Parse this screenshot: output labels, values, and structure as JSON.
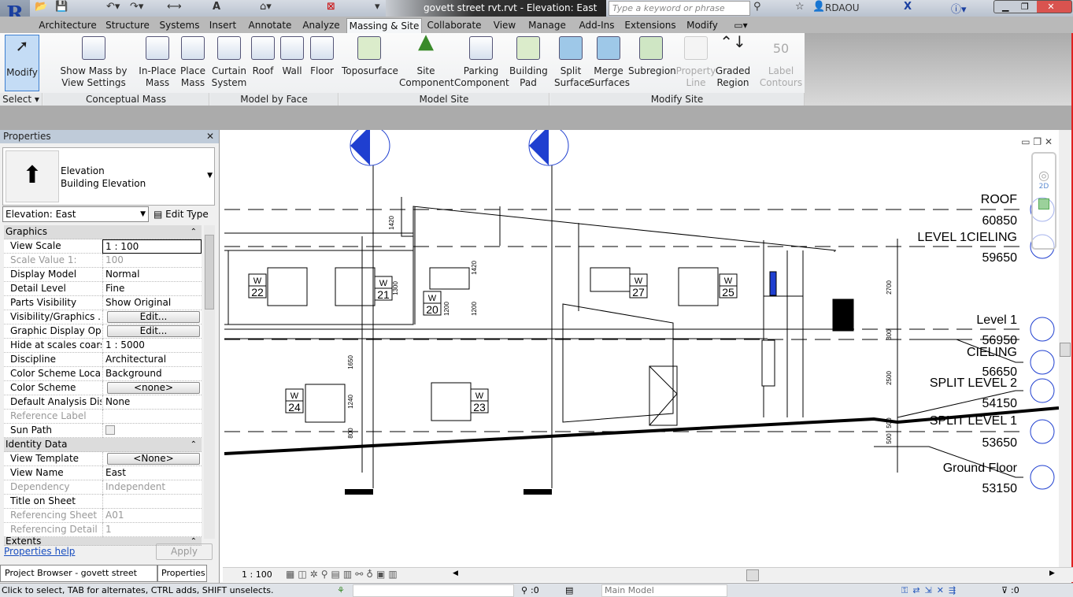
{
  "titlebar": {
    "document_title": "govett street rvt.rvt - Elevation: East",
    "search_placeholder": "Type a keyword or phrase",
    "user": "RDAOU"
  },
  "tabs": [
    "Architecture",
    "Structure",
    "Systems",
    "Insert",
    "Annotate",
    "Analyze",
    "Massing & Site",
    "Collaborate",
    "View",
    "Manage",
    "Add-Ins",
    "Extensions",
    "Modify"
  ],
  "active_tab": "Massing & Site",
  "ribbon": {
    "select": {
      "button": "Modify",
      "panel": "Select"
    },
    "conceptual_mass": {
      "panel": "Conceptual Mass",
      "buttons": [
        "Show Mass by View Settings",
        "In-Place Mass",
        "Place Mass"
      ]
    },
    "model_by_face": {
      "panel": "Model by Face",
      "buttons": [
        "Curtain System",
        "Roof",
        "Wall",
        "Floor"
      ]
    },
    "model_site": {
      "panel": "Model Site",
      "buttons": [
        "Toposurface",
        "Site Component",
        "Parking Component",
        "Building Pad"
      ]
    },
    "modify_site": {
      "panel": "Modify Site",
      "buttons": [
        "Split Surface",
        "Merge Surfaces",
        "Subregion",
        "Property Line",
        "Graded Region",
        "Label Contours"
      ],
      "disabled": [
        "Property Line",
        "Label Contours"
      ]
    }
  },
  "properties": {
    "title": "Properties",
    "type_family": "Elevation",
    "type_name": "Building Elevation",
    "instance_selector": "Elevation: East",
    "edit_type": "Edit Type",
    "sections": {
      "graphics": "Graphics",
      "identity": "Identity Data",
      "extents": "Extents"
    },
    "rows": [
      {
        "k": "View Scale",
        "v": "1 : 100"
      },
      {
        "k": "Scale Value    1:",
        "v": "100"
      },
      {
        "k": "Display Model",
        "v": "Normal"
      },
      {
        "k": "Detail Level",
        "v": "Fine"
      },
      {
        "k": "Parts Visibility",
        "v": "Show Original"
      },
      {
        "k": "Visibility/Graphics ...",
        "v": "Edit..."
      },
      {
        "k": "Graphic Display Opt...",
        "v": "Edit..."
      },
      {
        "k": "Hide at scales coars...",
        "v": "1 : 5000"
      },
      {
        "k": "Discipline",
        "v": "Architectural"
      },
      {
        "k": "Color Scheme Loca...",
        "v": "Background"
      },
      {
        "k": "Color Scheme",
        "v": "<none>"
      },
      {
        "k": "Default Analysis Dis...",
        "v": "None"
      },
      {
        "k": "Reference Label",
        "v": ""
      },
      {
        "k": "Sun Path",
        "v": ""
      },
      {
        "k": "View Template",
        "v": "<None>"
      },
      {
        "k": "View Name",
        "v": "East"
      },
      {
        "k": "Dependency",
        "v": "Independent"
      },
      {
        "k": "Title on Sheet",
        "v": ""
      },
      {
        "k": "Referencing Sheet",
        "v": "A01"
      },
      {
        "k": "Referencing Detail",
        "v": "1"
      }
    ],
    "help": "Properties help",
    "apply": "Apply",
    "bottom_tabs": [
      "Project Browser - govett street rvt.rvt",
      "Properties"
    ]
  },
  "drawing": {
    "levels": [
      {
        "name": "ROOF",
        "elev": "60850"
      },
      {
        "name": "LEVEL 1CIELING",
        "elev": "59650"
      },
      {
        "name": "Level 1",
        "elev": "56950"
      },
      {
        "name": "CIELING",
        "elev": "56650"
      },
      {
        "name": "SPLIT LEVEL 2",
        "elev": "54150"
      },
      {
        "name": "SPLIT LEVEL 1",
        "elev": "53650"
      },
      {
        "name": "Ground Floor",
        "elev": "53150"
      }
    ],
    "window_tags": [
      "22",
      "21",
      "20",
      "27",
      "25",
      "24",
      "23"
    ],
    "window_tag_prefix": "W",
    "dimensions": [
      "1420",
      "1300",
      "1420",
      "1200",
      "1200",
      "1650",
      "1240",
      "800",
      "2700",
      "300",
      "2500",
      "500",
      "500"
    ],
    "nav_label": "2D"
  },
  "viewbar": {
    "scale": "1 : 100"
  },
  "status": {
    "message": "Click to select, TAB for alternates, CTRL adds, SHIFT unselects.",
    "filter_count": ":0",
    "model": "Main Model",
    "selection_count": ":0"
  },
  "colors": {
    "accent": "#1f4fbf",
    "bubble": "#1f3fd0",
    "active_button": "#c4dcf5"
  }
}
